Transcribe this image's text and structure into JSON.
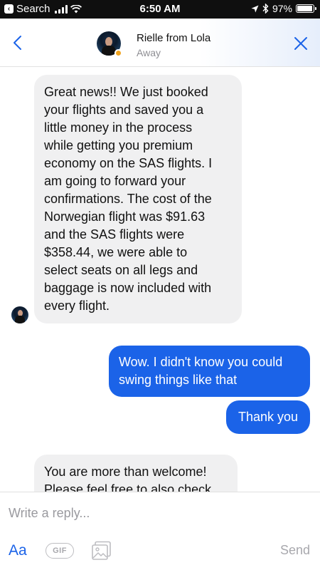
{
  "status_bar": {
    "back_label": "Search",
    "time": "6:50 AM",
    "battery_percent": "97%",
    "battery_level": 0.97
  },
  "header": {
    "contact_name": "Rielle from Lola",
    "contact_status": "Away",
    "presence_color": "#f0a31e"
  },
  "messages": [
    {
      "direction": "incoming",
      "lines": [
        "Great news!! We just booked",
        "your flights and saved you a",
        "little money in the process",
        "while getting you premium",
        "economy on the SAS flights. I",
        "am going to forward your",
        "confirmations. The cost of the",
        "Norwegian flight was $91.63",
        "and the SAS flights were",
        "$358.44, we were able to",
        "select seats on all legs and",
        "baggage is now included with",
        "every flight."
      ]
    },
    {
      "direction": "outgoing",
      "lines": [
        "Wow. I didn't know you could",
        "swing things like that"
      ]
    },
    {
      "direction": "outgoing",
      "lines": [
        "Thank you"
      ]
    },
    {
      "direction": "incoming",
      "lines": [
        "You are more than welcome!",
        "Please feel free to also check"
      ]
    }
  ],
  "composer": {
    "placeholder": "Write a reply...",
    "aa_label": "Aa",
    "gif_label": "GIF",
    "send_label": "Send"
  },
  "colors": {
    "accent": "#1b63e8",
    "incoming_bubble": "#f0f0f1",
    "status_bar": "#0f0f0f"
  },
  "icons": {
    "back": "chevron-left-icon",
    "close": "close-icon",
    "photo": "photo-icon",
    "wifi": "wifi-icon",
    "location": "location-arrow-icon",
    "bluetooth": "bluetooth-icon"
  }
}
